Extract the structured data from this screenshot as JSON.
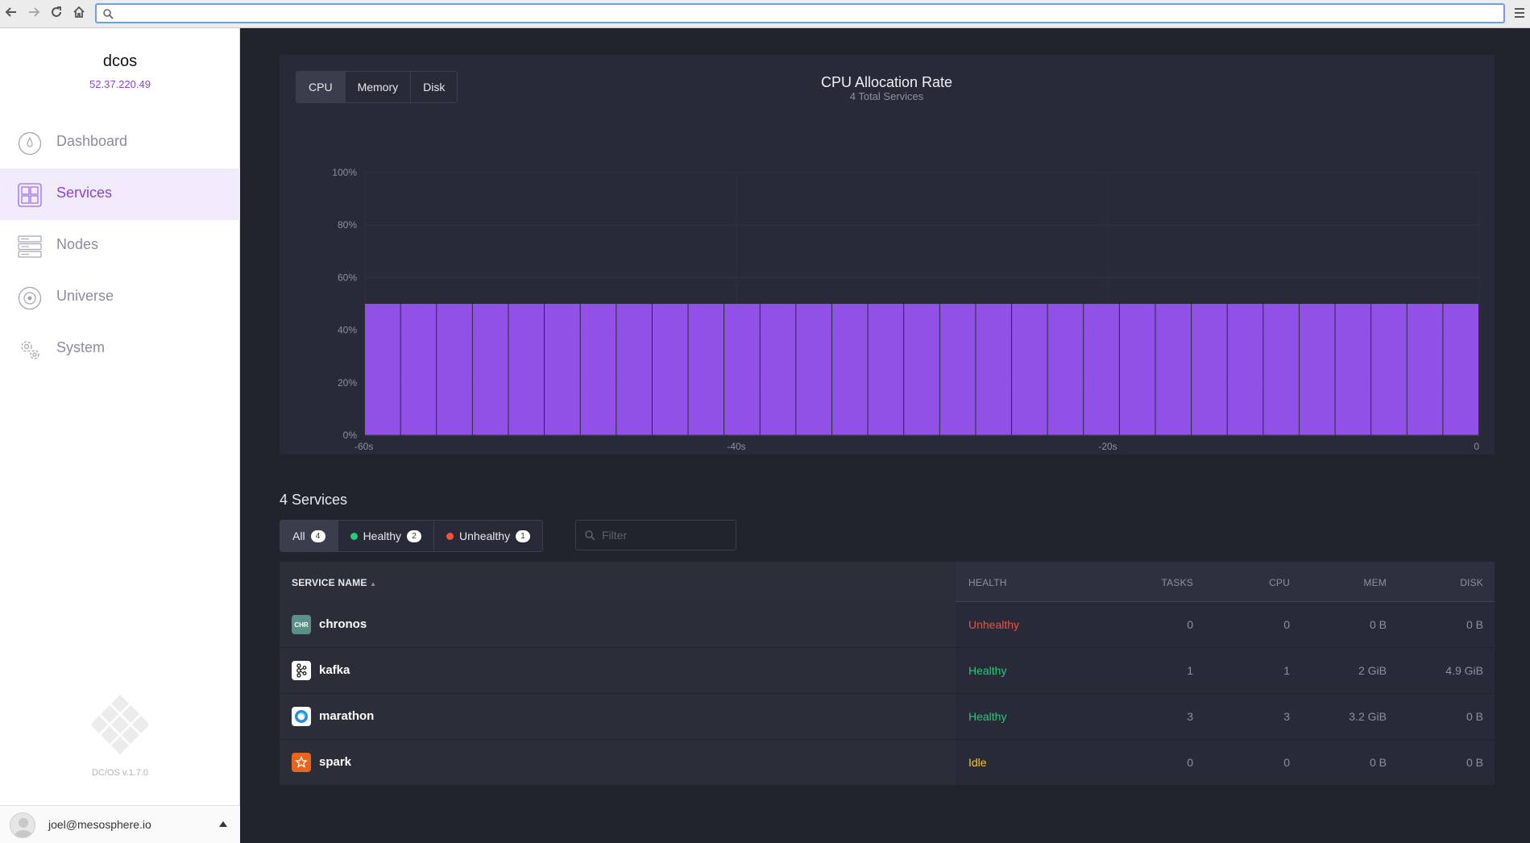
{
  "browser": {
    "url_placeholder": "",
    "back_icon": "back-arrow-icon",
    "forward_icon": "forward-arrow-icon",
    "reload_icon": "reload-icon",
    "home_icon": "home-icon",
    "menu_icon": "hamburger-menu-icon"
  },
  "sidebar": {
    "cluster_name": "dcos",
    "cluster_ip": "52.37.220.49",
    "items": [
      {
        "label": "Dashboard",
        "icon": "dashboard-icon",
        "active": false
      },
      {
        "label": "Services",
        "icon": "services-icon",
        "active": true
      },
      {
        "label": "Nodes",
        "icon": "nodes-icon",
        "active": false
      },
      {
        "label": "Universe",
        "icon": "universe-icon",
        "active": false
      },
      {
        "label": "System",
        "icon": "system-icon",
        "active": false
      }
    ],
    "version": "DC/OS v.1.7.0",
    "user_email": "joel@mesosphere.io"
  },
  "chart_panel": {
    "tabs": [
      "CPU",
      "Memory",
      "Disk"
    ],
    "active_tab": "CPU",
    "title": "CPU Allocation Rate",
    "subtitle": "4 Total Services"
  },
  "chart_data": {
    "type": "bar",
    "title": "CPU Allocation Rate",
    "subtitle": "4 Total Services",
    "xlabel": "",
    "ylabel": "",
    "ylim": [
      0,
      100
    ],
    "y_ticks": [
      "0%",
      "20%",
      "40%",
      "60%",
      "80%",
      "100%"
    ],
    "x_ticks": [
      "-60s",
      "-40s",
      "-20s",
      "0"
    ],
    "xlim": [
      -60,
      0
    ],
    "bar_color": "#9150e6",
    "values": [
      50,
      50,
      50,
      50,
      50,
      50,
      50,
      50,
      50,
      50,
      50,
      50,
      50,
      50,
      50,
      50,
      50,
      50,
      50,
      50,
      50,
      50,
      50,
      50,
      50,
      50,
      50,
      50,
      50,
      50,
      50
    ]
  },
  "services": {
    "title": "4 Services",
    "filters": [
      {
        "label": "All",
        "count": "4",
        "dot": null,
        "active": true
      },
      {
        "label": "Healthy",
        "count": "2",
        "dot": "#27c97b",
        "active": false
      },
      {
        "label": "Unhealthy",
        "count": "1",
        "dot": "#f34e3f",
        "active": false
      }
    ],
    "filter_placeholder": "Filter",
    "columns": {
      "name": "SERVICE NAME",
      "health": "HEALTH",
      "tasks": "TASKS",
      "cpu": "CPU",
      "mem": "MEM",
      "disk": "DISK"
    },
    "rows": [
      {
        "name": "chronos",
        "icon_text": "CHR",
        "icon_color": "#5a8f8a",
        "health": "Unhealthy",
        "health_color": "#f34e3f",
        "tasks": "0",
        "cpu": "0",
        "mem": "0 B",
        "disk": "0 B"
      },
      {
        "name": "kafka",
        "icon_text": "",
        "icon_color": "#ffffff",
        "health": "Healthy",
        "health_color": "#27c97b",
        "tasks": "1",
        "cpu": "1",
        "mem": "2 GiB",
        "disk": "4.9 GiB"
      },
      {
        "name": "marathon",
        "icon_text": "",
        "icon_color": "#ffffff",
        "health": "Healthy",
        "health_color": "#27c97b",
        "tasks": "3",
        "cpu": "3",
        "mem": "3.2 GiB",
        "disk": "0 B"
      },
      {
        "name": "spark",
        "icon_text": "",
        "icon_color": "#e8651e",
        "health": "Idle",
        "health_color": "#fec722",
        "tasks": "0",
        "cpu": "0",
        "mem": "0 B",
        "disk": "0 B"
      }
    ]
  }
}
